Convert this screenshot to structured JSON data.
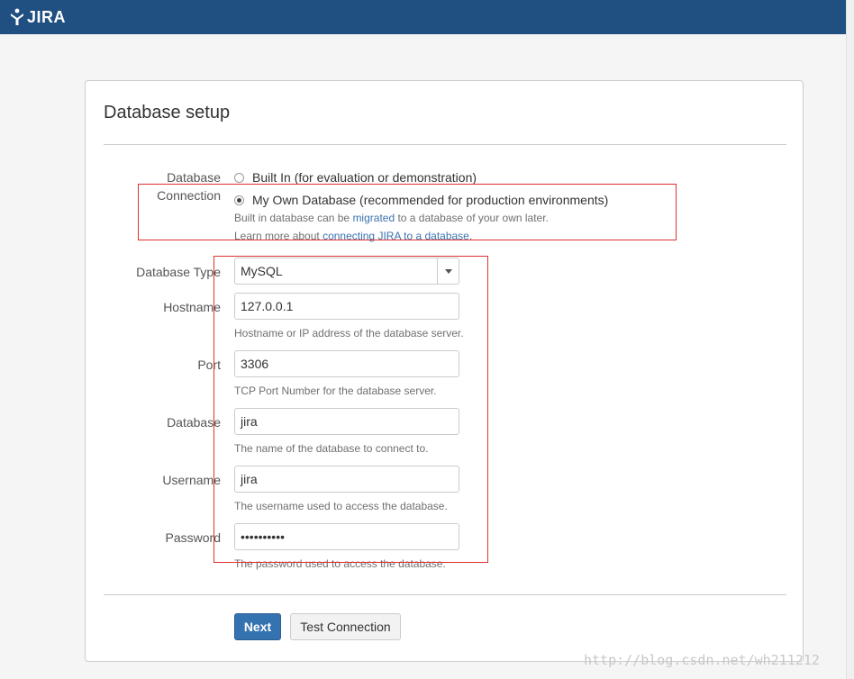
{
  "header": {
    "logo_text": "JIRA"
  },
  "page": {
    "title": "Database setup"
  },
  "connection": {
    "label_line1": "Database",
    "label_line2": "Connection",
    "option_builtin": "Built In (for evaluation or demonstration)",
    "option_own": "My Own Database (recommended for production environments)",
    "selected": "own",
    "hint1_pre": "Built in database can be ",
    "hint1_link": "migrated",
    "hint1_post": " to a database of your own later.",
    "hint2_pre": "Learn more about ",
    "hint2_link": "connecting JIRA to a database",
    "hint2_post": "."
  },
  "fields": {
    "db_type": {
      "label": "Database Type",
      "value": "MySQL"
    },
    "hostname": {
      "label": "Hostname",
      "value": "127.0.0.1",
      "hint": "Hostname or IP address of the database server."
    },
    "port": {
      "label": "Port",
      "value": "3306",
      "hint": "TCP Port Number for the database server."
    },
    "database": {
      "label": "Database",
      "value": "jira",
      "hint": "The name of the database to connect to."
    },
    "username": {
      "label": "Username",
      "value": "jira",
      "hint": "The username used to access the database."
    },
    "password": {
      "label": "Password",
      "value": "••••••••••",
      "hint": "The password used to access the database."
    }
  },
  "actions": {
    "next": "Next",
    "test": "Test Connection"
  },
  "watermark": "http://blog.csdn.net/wh211212",
  "colors": {
    "header": "#205081",
    "primary": "#3572b0",
    "link": "#3b73af",
    "annotation": "#e03030"
  }
}
